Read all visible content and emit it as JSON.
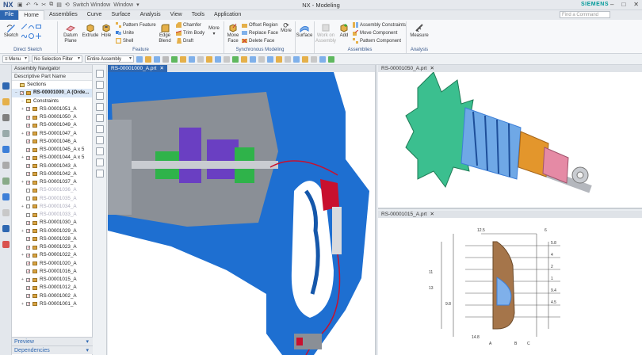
{
  "app": {
    "logo": "NX",
    "title": "NX - Modeling",
    "brand": "SIEMENS",
    "quick_access": [
      "Switch Window",
      "Window"
    ],
    "command_finder_placeholder": "Find a Command"
  },
  "menu": {
    "file": "File",
    "tabs": [
      "Home",
      "Assemblies",
      "Curve",
      "Surface",
      "Analysis",
      "View",
      "Tools",
      "Application"
    ],
    "active_tab": "Home"
  },
  "ribbon": {
    "sketch": "Sketch",
    "direct_sketch": "Direct Sketch",
    "datum_plane": "Datum Plane",
    "extrude": "Extrude",
    "hole": "Hole",
    "pattern_feature": "Pattern Feature",
    "unite": "Unite",
    "shell": "Shell",
    "edge_blend": "Edge Blend",
    "chamfer": "Chamfer",
    "trim_body": "Trim Body",
    "draft": "Draft",
    "more1": "More",
    "feature": "Feature",
    "move_face": "Move Face",
    "offset_region": "Offset Region",
    "replace_face": "Replace Face",
    "delete_face": "Delete Face",
    "more2": "More",
    "synchronous_modeling": "Synchronous Modeling",
    "surface": "Surface",
    "work_on_assembly": "Work on Assembly",
    "add": "Add",
    "assembly_constraints": "Assembly Constraints",
    "move_component": "Move Component",
    "pattern_component": "Pattern Component",
    "assemblies": "Assemblies",
    "measure": "Measure",
    "analysis": "Analysis"
  },
  "selection_bar": {
    "menu": "Menu",
    "filter": "No Selection Filter",
    "scope": "Entire Assembly"
  },
  "navigator": {
    "title": "Assembly Navigator",
    "column": "Descriptive Part Name",
    "rows": [
      {
        "label": "Sections",
        "kind": "folder",
        "indent": 0,
        "state": "none"
      },
      {
        "label": "RS-00001000_A (Orde...",
        "kind": "root",
        "indent": 0,
        "state": "checked"
      },
      {
        "label": "Constraints",
        "kind": "folder",
        "indent": 1,
        "state": "none"
      },
      {
        "label": "RS-00001051_A",
        "kind": "part",
        "indent": 1,
        "state": "checked"
      },
      {
        "label": "RS-00001050_A",
        "kind": "part",
        "indent": 1,
        "state": "checked"
      },
      {
        "label": "RS-00001049_A",
        "kind": "part",
        "indent": 1,
        "state": "checked"
      },
      {
        "label": "RS-00001047_A",
        "kind": "part",
        "indent": 1,
        "state": "checked"
      },
      {
        "label": "RS-00001046_A",
        "kind": "part",
        "indent": 1,
        "state": "checked"
      },
      {
        "label": "RS-00001045_A x 5",
        "kind": "part",
        "indent": 1,
        "state": "checked"
      },
      {
        "label": "RS-00001044_A x 5",
        "kind": "part",
        "indent": 1,
        "state": "checked"
      },
      {
        "label": "RS-00001043_A",
        "kind": "part",
        "indent": 1,
        "state": "checked"
      },
      {
        "label": "RS-00001042_A",
        "kind": "part",
        "indent": 1,
        "state": "checked"
      },
      {
        "label": "RS-00001037_A",
        "kind": "part",
        "indent": 1,
        "state": "checked"
      },
      {
        "label": "RS-00001036_A",
        "kind": "part",
        "indent": 1,
        "state": "grey"
      },
      {
        "label": "RS-00001035_A",
        "kind": "part",
        "indent": 1,
        "state": "grey"
      },
      {
        "label": "RS-00001034_A",
        "kind": "part",
        "indent": 1,
        "state": "grey"
      },
      {
        "label": "RS-00001033_A",
        "kind": "part",
        "indent": 1,
        "state": "grey"
      },
      {
        "label": "RS-00001030_A",
        "kind": "part",
        "indent": 1,
        "state": "checked"
      },
      {
        "label": "RS-00001029_A",
        "kind": "part",
        "indent": 1,
        "state": "checked"
      },
      {
        "label": "RS-00001028_A",
        "kind": "part",
        "indent": 1,
        "state": "checked"
      },
      {
        "label": "RS-00001023_A",
        "kind": "part",
        "indent": 1,
        "state": "checked"
      },
      {
        "label": "RS-00001022_A",
        "kind": "part",
        "indent": 1,
        "state": "checked"
      },
      {
        "label": "RS-00001020_A",
        "kind": "part",
        "indent": 1,
        "state": "checked"
      },
      {
        "label": "RS-00001016_A",
        "kind": "part",
        "indent": 1,
        "state": "checked"
      },
      {
        "label": "RS-00001015_A",
        "kind": "part",
        "indent": 1,
        "state": "checked"
      },
      {
        "label": "RS-00001012_A",
        "kind": "part",
        "indent": 1,
        "state": "checked"
      },
      {
        "label": "RS-00001002_A",
        "kind": "part",
        "indent": 1,
        "state": "checked"
      },
      {
        "label": "RS-00001001_A",
        "kind": "part",
        "indent": 1,
        "state": "checked"
      }
    ],
    "preview": "Preview",
    "dependencies": "Dependencies"
  },
  "viewports": {
    "main_tab": "RS-00001000_A.prt",
    "top_right_tab": "RS-00001050_A.prt",
    "bottom_right_tab": "RS-00001015_A.prt"
  },
  "drawing": {
    "dims": [
      "12.5",
      "6",
      "5.8",
      "4",
      "2",
      "1",
      "9.4",
      "4.5",
      "11",
      "13",
      "9.8",
      "14.8",
      "A",
      "B",
      "C"
    ]
  },
  "colors": {
    "accent": "#2e67b1",
    "housing": "#1e6fd1",
    "armature_green": "#3bbf8f",
    "armature_orange": "#e3962c",
    "pinion_pink": "#e58aa5"
  }
}
